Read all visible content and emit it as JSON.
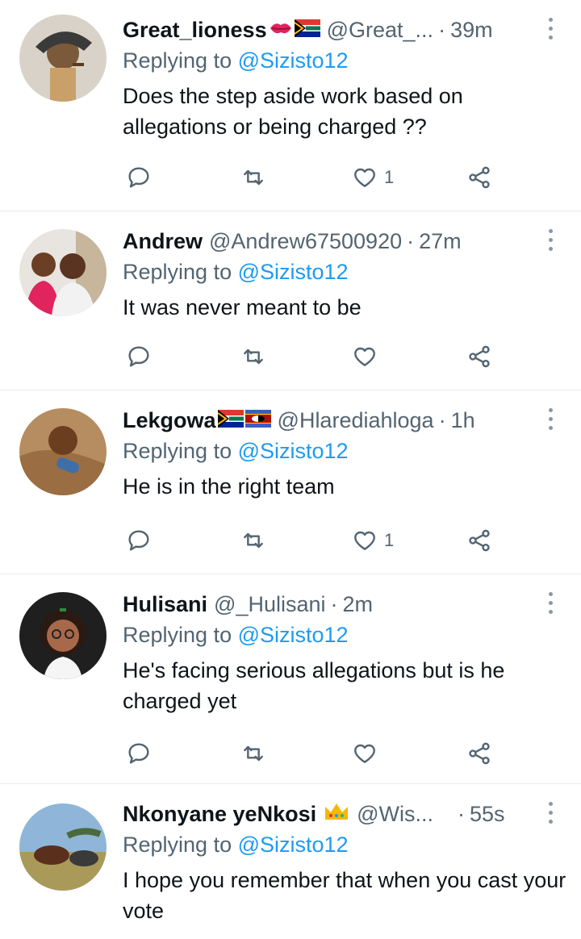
{
  "replying_prefix": "Replying to",
  "colors": {
    "link": "#1d9bf0",
    "secondary": "#536471",
    "text": "#0f1419",
    "divider": "#e6ecf0"
  },
  "tweets": [
    {
      "name": "Great_lioness",
      "name_emojis": [
        "kiss-mark-emoji",
        "south-africa-flag-emoji"
      ],
      "handle": "@Great_...",
      "dot": "·",
      "time": "39m",
      "reply_to": "@Sizisto12",
      "text": "Does the step aside work based on allegations or being charged ??",
      "like_count": "1"
    },
    {
      "name": "Andrew",
      "name_emojis": [],
      "handle": "@Andrew67500920",
      "dot": "·",
      "time": "27m",
      "reply_to": "@Sizisto12",
      "text": "It was never meant to be",
      "like_count": ""
    },
    {
      "name": "Lekgowa",
      "name_emojis": [
        "south-africa-flag-emoji",
        "eswatini-flag-emoji"
      ],
      "handle": "@Hlarediahloga",
      "dot": "·",
      "time": "1h",
      "reply_to": "@Sizisto12",
      "text": "He is in the right team",
      "like_count": "1"
    },
    {
      "name": "Hulisani",
      "name_emojis": [],
      "handle": "@_Hulisani",
      "dot": "·",
      "time": "2m",
      "reply_to": "@Sizisto12",
      "text": "He's facing serious allegations but is he charged yet",
      "like_count": ""
    },
    {
      "name": "Nkonyane yeNkosi",
      "name_emojis": [
        "crown-emoji"
      ],
      "handle": "@Wis...",
      "dot": "·",
      "time": "55s",
      "reply_to": "@Sizisto12",
      "text": "I hope you remember that when you cast your vote",
      "like_count": ""
    }
  ]
}
